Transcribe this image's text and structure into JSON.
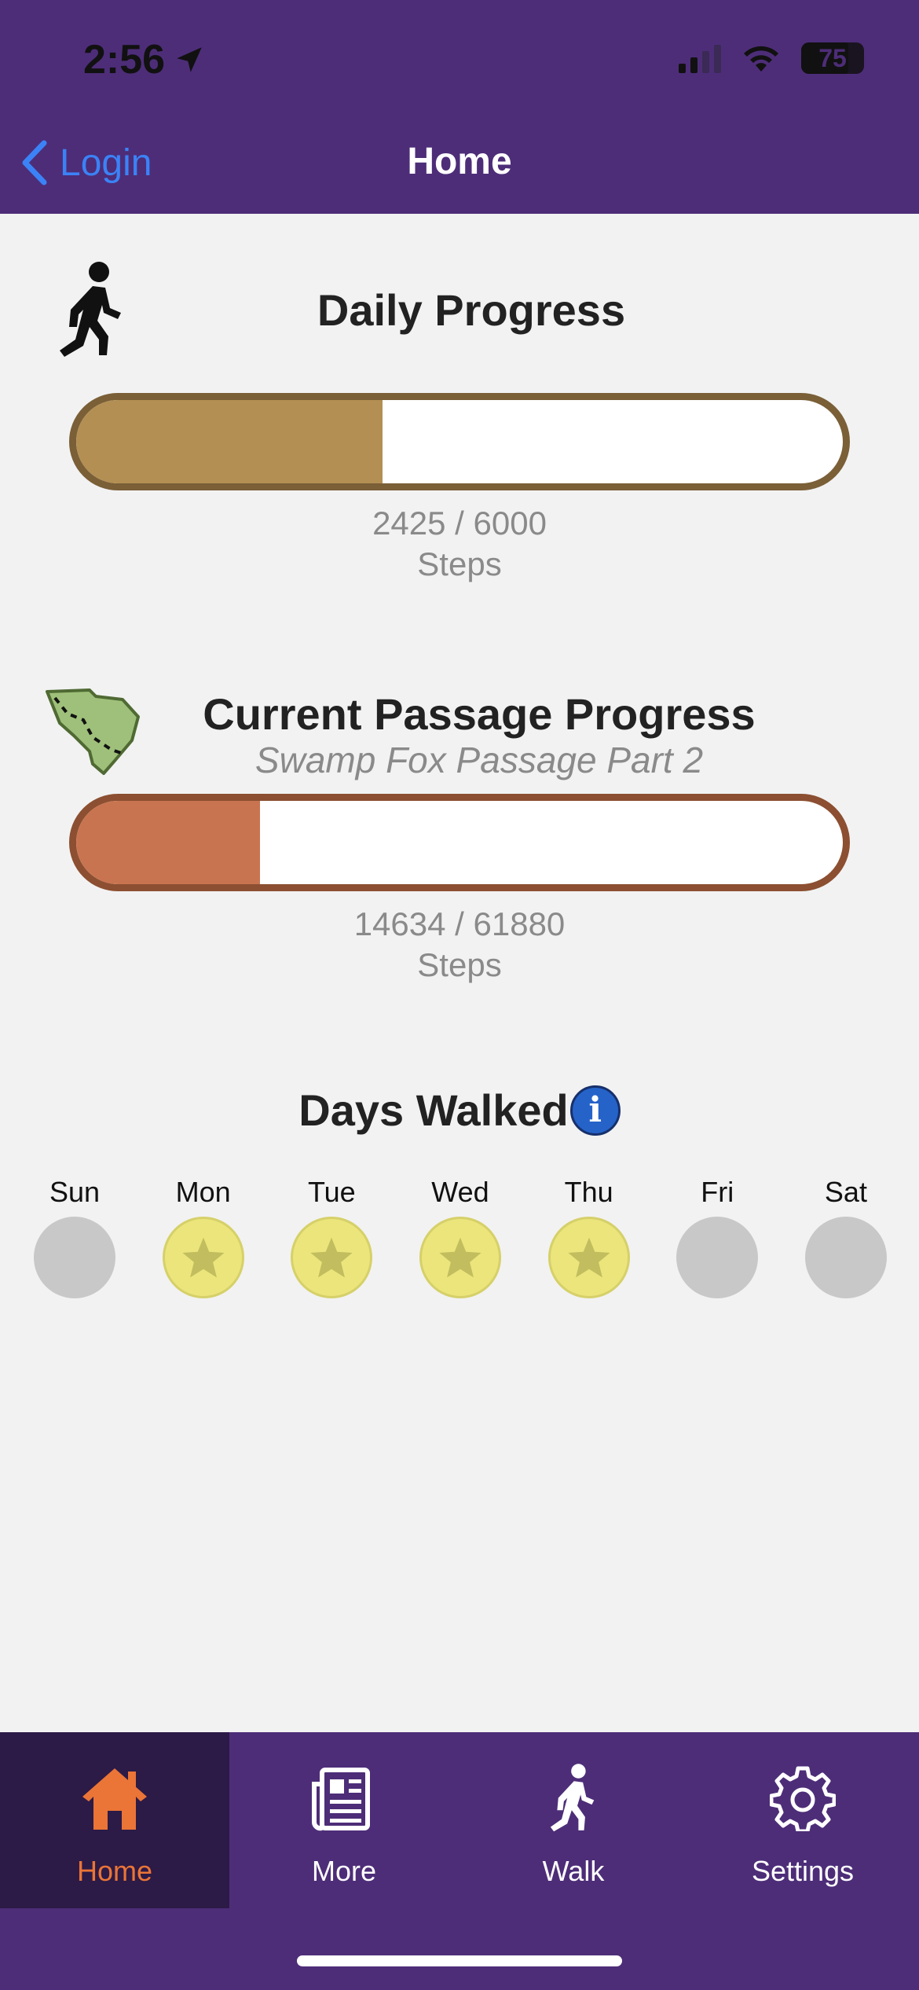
{
  "status_bar": {
    "time": "2:56",
    "battery": "75"
  },
  "nav": {
    "back_label": "Login",
    "title": "Home"
  },
  "daily": {
    "title": "Daily Progress",
    "current": 2425,
    "goal": 6000,
    "progress_text": "2425 / 6000",
    "unit": "Steps",
    "progress_fraction": 0.4,
    "bar_color": "#b38f53",
    "border_color": "#7a5f37"
  },
  "passage": {
    "title": "Current Passage Progress",
    "subtitle": "Swamp Fox Passage Part 2",
    "current": 14634,
    "goal": 61880,
    "progress_text": "14634 / 61880",
    "unit": "Steps",
    "progress_fraction": 0.24,
    "bar_color": "#c97450",
    "border_color": "#8c4f31"
  },
  "days_walked": {
    "title": "Days Walked",
    "days": [
      {
        "label": "Sun",
        "walked": false
      },
      {
        "label": "Mon",
        "walked": true
      },
      {
        "label": "Tue",
        "walked": true
      },
      {
        "label": "Wed",
        "walked": true
      },
      {
        "label": "Thu",
        "walked": true
      },
      {
        "label": "Fri",
        "walked": false
      },
      {
        "label": "Sat",
        "walked": false
      }
    ]
  },
  "tabs": [
    {
      "label": "Home",
      "icon": "house-icon",
      "active": true
    },
    {
      "label": "More",
      "icon": "newspaper-icon",
      "active": false
    },
    {
      "label": "Walk",
      "icon": "walker-icon",
      "active": false
    },
    {
      "label": "Settings",
      "icon": "gear-icon",
      "active": false
    }
  ],
  "colors": {
    "brand": "#4d2d78",
    "accent": "#ea7536",
    "link": "#3b82f6"
  }
}
